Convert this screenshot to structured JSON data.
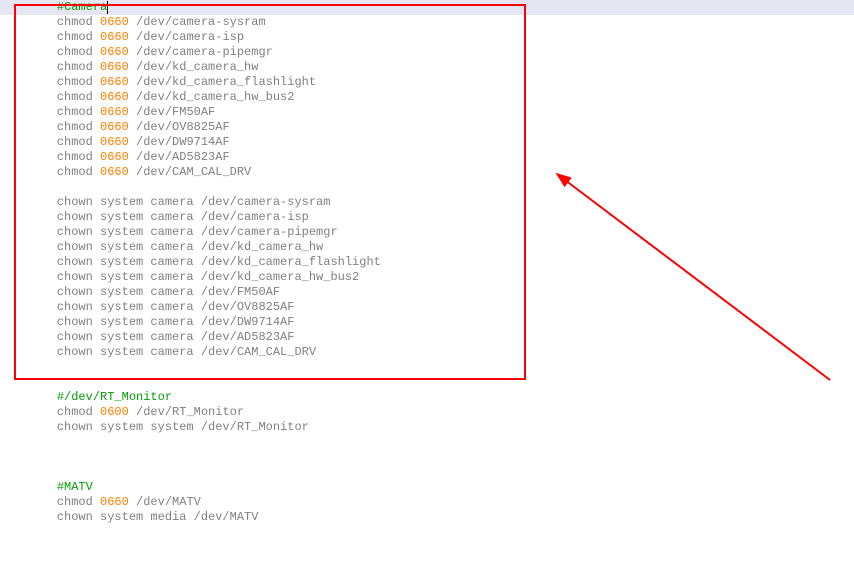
{
  "code": {
    "section1_comment": "#Camera",
    "chmod": [
      {
        "cmd": "chmod",
        "mode": "0660",
        "path": "/dev/camera-sysram"
      },
      {
        "cmd": "chmod",
        "mode": "0660",
        "path": "/dev/camera-isp"
      },
      {
        "cmd": "chmod",
        "mode": "0660",
        "path": "/dev/camera-pipemgr"
      },
      {
        "cmd": "chmod",
        "mode": "0660",
        "path": "/dev/kd_camera_hw"
      },
      {
        "cmd": "chmod",
        "mode": "0660",
        "path": "/dev/kd_camera_flashlight"
      },
      {
        "cmd": "chmod",
        "mode": "0660",
        "path": "/dev/kd_camera_hw_bus2"
      },
      {
        "cmd": "chmod",
        "mode": "0660",
        "path": "/dev/FM50AF"
      },
      {
        "cmd": "chmod",
        "mode": "0660",
        "path": "/dev/OV8825AF"
      },
      {
        "cmd": "chmod",
        "mode": "0660",
        "path": "/dev/DW9714AF"
      },
      {
        "cmd": "chmod",
        "mode": "0660",
        "path": "/dev/AD5823AF"
      },
      {
        "cmd": "chmod",
        "mode": "0660",
        "path": "/dev/CAM_CAL_DRV"
      }
    ],
    "chown": [
      {
        "cmd": "chown",
        "owner": "system camera",
        "path": "/dev/camera-sysram"
      },
      {
        "cmd": "chown",
        "owner": "system camera",
        "path": "/dev/camera-isp"
      },
      {
        "cmd": "chown",
        "owner": "system camera",
        "path": "/dev/camera-pipemgr"
      },
      {
        "cmd": "chown",
        "owner": "system camera",
        "path": "/dev/kd_camera_hw"
      },
      {
        "cmd": "chown",
        "owner": "system camera",
        "path": "/dev/kd_camera_flashlight"
      },
      {
        "cmd": "chown",
        "owner": "system camera",
        "path": "/dev/kd_camera_hw_bus2"
      },
      {
        "cmd": "chown",
        "owner": "system camera",
        "path": "/dev/FM50AF"
      },
      {
        "cmd": "chown",
        "owner": "system camera",
        "path": "/dev/OV8825AF"
      },
      {
        "cmd": "chown",
        "owner": "system camera",
        "path": "/dev/DW9714AF"
      },
      {
        "cmd": "chown",
        "owner": "system camera",
        "path": "/dev/AD5823AF"
      },
      {
        "cmd": "chown",
        "owner": "system camera",
        "path": "/dev/CAM_CAL_DRV"
      }
    ],
    "section2_comment": "#/dev/RT_Monitor",
    "rt": [
      {
        "cmd": "chmod",
        "mode": "0600",
        "path": "/dev/RT_Monitor"
      },
      {
        "cmd": "chown",
        "owner": "system system",
        "path": "/dev/RT_Monitor"
      }
    ],
    "section3_comment": "#MATV",
    "matv": [
      {
        "cmd": "chmod",
        "mode": "0660",
        "path": "/dev/MATV"
      },
      {
        "cmd": "chown",
        "owner": "system media",
        "path": "/dev/MATV"
      }
    ]
  },
  "annotation": {
    "box_color": "#ff0000",
    "arrow_color": "#ff0000"
  }
}
